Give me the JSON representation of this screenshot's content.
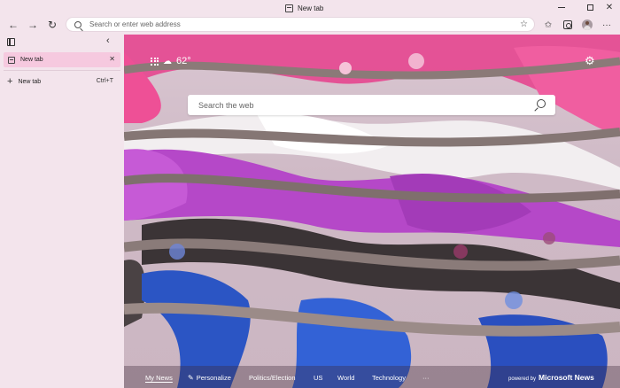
{
  "window": {
    "title": "New tab",
    "minimize_icon": "minimize-icon",
    "maximize_icon": "maximize-icon",
    "close_glyph": "✕"
  },
  "toolbar": {
    "back_glyph": "←",
    "forward_glyph": "→",
    "reload_glyph": "↻",
    "address_placeholder": "Search or enter web address",
    "add_favorite_glyph": "☆",
    "favorites_glyph": "✩",
    "more_glyph": "···"
  },
  "tabs_panel": {
    "collapse_glyph": "‹",
    "tabs": [
      {
        "label": "New tab",
        "close_glyph": "✕"
      }
    ],
    "new_tab": {
      "plus_glyph": "+",
      "label": "New tab",
      "shortcut": "Ctrl+T"
    }
  },
  "new_tab_page": {
    "weather": {
      "temperature": "62°"
    },
    "settings_glyph": "⚙",
    "search_placeholder": "Search the web",
    "news_bar": {
      "items": [
        {
          "label": "My News",
          "active": true
        },
        {
          "label": "Personalize",
          "active": false
        },
        {
          "label": "Politics/Election",
          "active": false
        },
        {
          "label": "US",
          "active": false
        },
        {
          "label": "World",
          "active": false
        },
        {
          "label": "Technology",
          "active": false
        }
      ],
      "more_glyph": "···",
      "powered_by": "powered by",
      "brand": "Microsoft News"
    }
  },
  "colors": {
    "chrome_bg": "#f3e4ec",
    "active_tab_bg": "#f6c9df",
    "pink_fabric": "#e6468f",
    "white_fabric": "#f2eef0",
    "violet_fabric": "#b548c8",
    "dark_fabric": "#3b3436",
    "blue_fabric": "#2b55c4"
  }
}
